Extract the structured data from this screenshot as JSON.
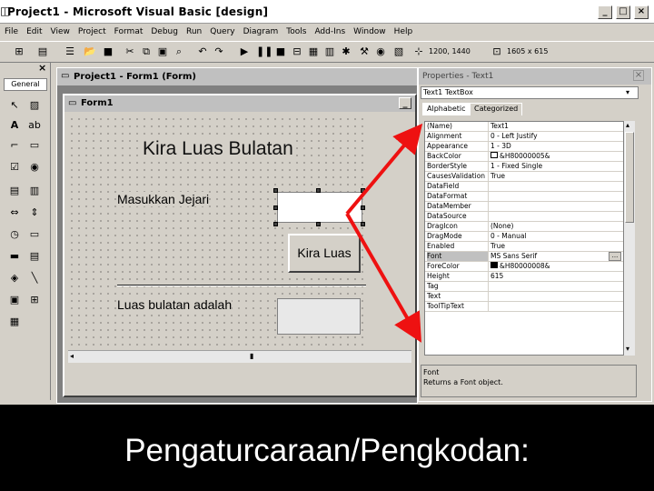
{
  "window": {
    "title": "Project1 - Microsoft Visual Basic [design]"
  },
  "menu": [
    "File",
    "Edit",
    "View",
    "Project",
    "Format",
    "Debug",
    "Run",
    "Query",
    "Diagram",
    "Tools",
    "Add-Ins",
    "Window",
    "Help"
  ],
  "toolbar": {
    "pos": "1200, 1440",
    "size": "1605 x 615"
  },
  "toolbox": {
    "title": "General"
  },
  "project_window": {
    "title": "Project1 - Form1 (Form)"
  },
  "form": {
    "caption": "Form1",
    "title_label": "Kira Luas Bulatan",
    "radius_label": "Masukkan Jejari",
    "button_label": "Kira Luas",
    "result_label": "Luas bulatan adalah"
  },
  "properties": {
    "title": "Properties - Text1",
    "object": "Text1 TextBox",
    "tabs": [
      "Alphabetic",
      "Categorized"
    ],
    "rows": [
      {
        "name": "(Name)",
        "value": "Text1"
      },
      {
        "name": "Alignment",
        "value": "0 - Left Justify"
      },
      {
        "name": "Appearance",
        "value": "1 - 3D"
      },
      {
        "name": "BackColor",
        "value": "&H80000005&"
      },
      {
        "name": "BorderStyle",
        "value": "1 - Fixed Single"
      },
      {
        "name": "CausesValidation",
        "value": "True"
      },
      {
        "name": "DataField",
        "value": ""
      },
      {
        "name": "DataFormat",
        "value": ""
      },
      {
        "name": "DataMember",
        "value": ""
      },
      {
        "name": "DataSource",
        "value": ""
      },
      {
        "name": "DragIcon",
        "value": "(None)"
      },
      {
        "name": "DragMode",
        "value": "0 - Manual"
      },
      {
        "name": "Enabled",
        "value": "True"
      },
      {
        "name": "Font",
        "value": "MS Sans Serif"
      },
      {
        "name": "ForeColor",
        "value": "&H80000008&"
      },
      {
        "name": "Height",
        "value": "615"
      },
      {
        "name": "Tag",
        "value": ""
      },
      {
        "name": "Text",
        "value": ""
      },
      {
        "name": "ToolTipText",
        "value": ""
      }
    ],
    "description_title": "Font",
    "description_text": "Returns a Font object."
  },
  "caption": "Pengaturcaraan/Pengkodan:"
}
